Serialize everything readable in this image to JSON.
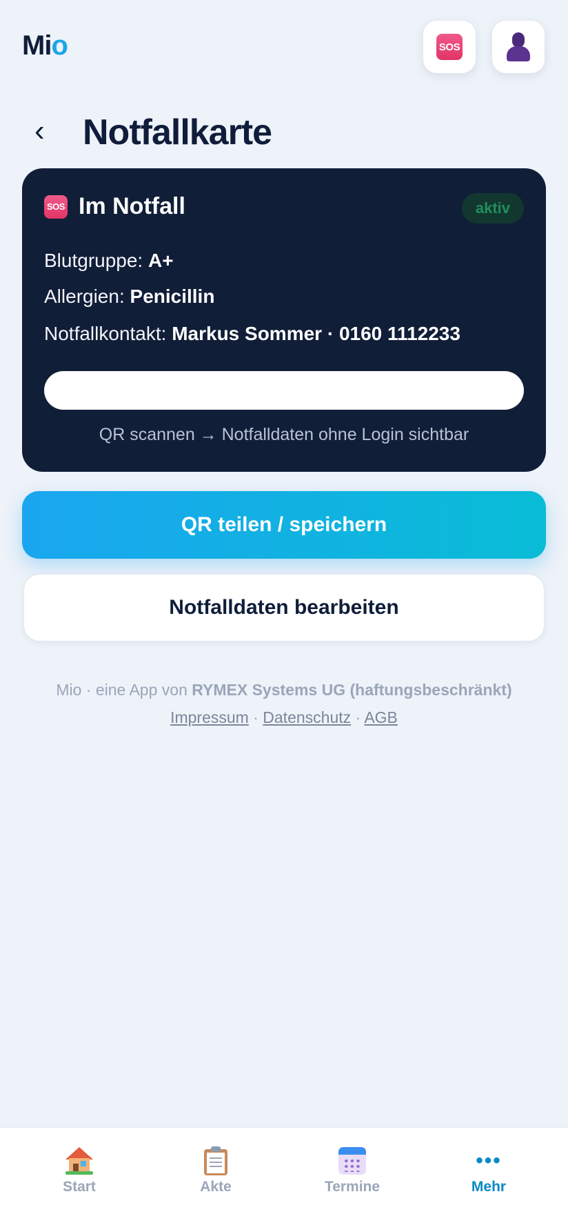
{
  "header": {
    "logo_main": "Mi",
    "logo_accent": "o",
    "sos_icon_text": "SOS"
  },
  "page": {
    "back_glyph": "‹",
    "title": "Notfallkarte"
  },
  "card": {
    "title": "Im Notfall",
    "badge": "aktiv",
    "blood_label": "Blutgruppe:",
    "blood_value": "A+",
    "allergy_label": "Allergien:",
    "allergy_value": "Penicillin",
    "contact_label": "Notfallkontakt:",
    "contact_value": "Markus Sommer · 0160 1112233",
    "qr_hint": "QR scannen → Notfalldaten ohne Login sichtbar"
  },
  "actions": {
    "share_label": "QR teilen / speichern",
    "edit_label": "Notfalldaten bearbeiten"
  },
  "footer": {
    "prefix": "Mio · eine App von",
    "company": "RYMEX Systems UG (haftungsbeschränkt)",
    "links": [
      "Impressum",
      "Datenschutz",
      "AGB"
    ],
    "separator": "·"
  },
  "tabs": [
    {
      "label": "Start",
      "icon": "house-icon"
    },
    {
      "label": "Akte",
      "icon": "clipboard-icon"
    },
    {
      "label": "Termine",
      "icon": "calendar-icon"
    },
    {
      "label": "Mehr",
      "icon": "more-icon",
      "active": true
    }
  ],
  "colors": {
    "accent": "#1aa6e8",
    "card_bg": "#111e38",
    "active_tab": "#0a89c6",
    "badge_text": "#1f8f5c"
  }
}
